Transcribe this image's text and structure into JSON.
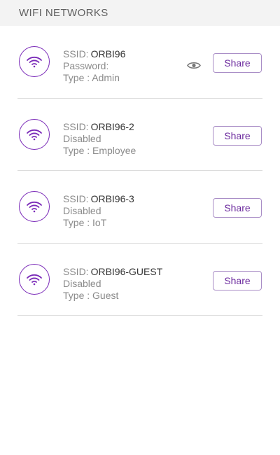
{
  "header": {
    "title": "WIFI NETWORKS"
  },
  "networks": [
    {
      "ssid_label": "SSID:",
      "ssid": "ORBI96",
      "status": "Password:",
      "type": "Type : Admin",
      "share_label": "Share",
      "icon": "wifi-icon",
      "show_password_icon": "eye-icon"
    },
    {
      "ssid_label": "SSID:",
      "ssid": "ORBI96-2",
      "status": "Disabled",
      "type": "Type : Employee",
      "share_label": "Share",
      "icon": "wifi-icon"
    },
    {
      "ssid_label": "SSID:",
      "ssid": "ORBI96-3",
      "status": "Disabled",
      "type": "Type : IoT",
      "share_label": "Share",
      "icon": "wifi-icon"
    },
    {
      "ssid_label": "SSID:",
      "ssid": "ORBI96-GUEST",
      "status": "Disabled",
      "type": "Type : Guest",
      "share_label": "Share",
      "icon": "wifi-icon"
    }
  ],
  "colors": {
    "accent": "#7a2ab8",
    "button_text": "#6c2b9e",
    "header_bg": "#f3f3f3",
    "divider": "#dcdcdc"
  }
}
